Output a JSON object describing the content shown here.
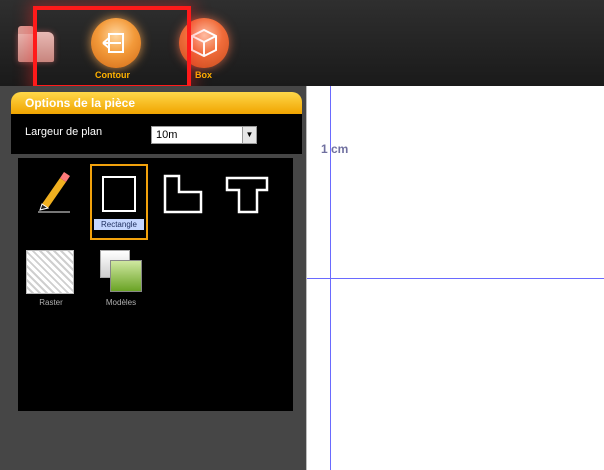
{
  "toolbar": {
    "contour_label": "Contour",
    "box_label": "Box"
  },
  "panel": {
    "header_title": "Options de la pièce",
    "largeur_label": "Largeur de plan",
    "largeur_value": "10m"
  },
  "tools": {
    "rectangle_label": "Rectangle",
    "raster_label": "Raster",
    "modeles_label": "Modèles"
  },
  "canvas": {
    "scale_label": "1 cm"
  },
  "colors": {
    "accent": "#f2a20c",
    "highlight_box": "#ff1a1a",
    "axis_line": "#6a6aff"
  },
  "icons": [
    "folder-icon",
    "contour-icon",
    "box-icon",
    "pencil-icon",
    "rectangle-shape-icon",
    "l-shape-icon",
    "t-shape-icon",
    "raster-icon",
    "modeles-icon"
  ]
}
